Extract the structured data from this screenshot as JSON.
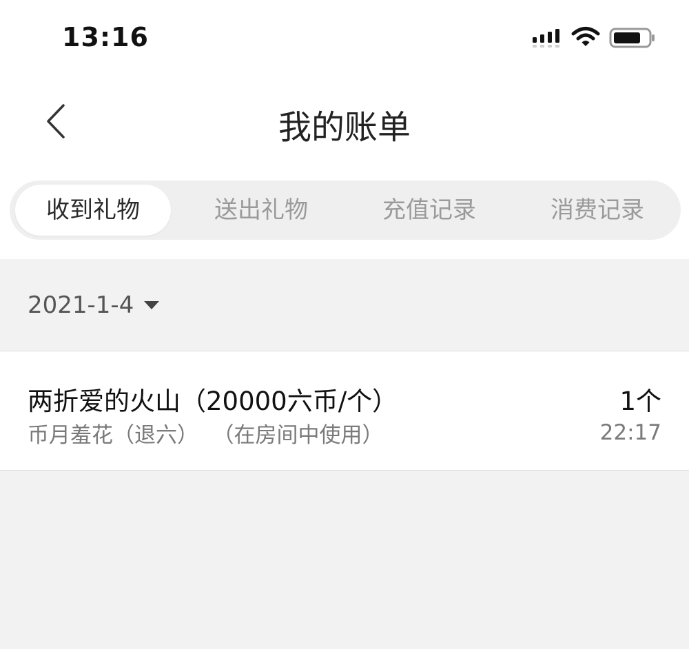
{
  "status_bar": {
    "time": "13:16",
    "icons": [
      "signal-icon",
      "wifi-icon",
      "battery-icon"
    ]
  },
  "nav": {
    "title": "我的账单",
    "back_icon": "chevron-left-icon"
  },
  "tabs": [
    {
      "label": "收到礼物",
      "active": true
    },
    {
      "label": "送出礼物",
      "active": false
    },
    {
      "label": "充值记录",
      "active": false
    },
    {
      "label": "消费记录",
      "active": false
    }
  ],
  "filter": {
    "date": "2021-1-4",
    "icon": "caret-down-icon"
  },
  "records": [
    {
      "gift_name": "两折爱的火山（20000六币/个）",
      "sender": "币月羞花（退六）",
      "usage": "（在房间中使用）",
      "count": "1个",
      "time": "22:17"
    }
  ],
  "colors": {
    "page_background": "#f2f2f2",
    "active_tab_text": "#2a2a2a",
    "inactive_tab_text": "#9a9a9a",
    "secondary_text": "#7a7a7a"
  }
}
